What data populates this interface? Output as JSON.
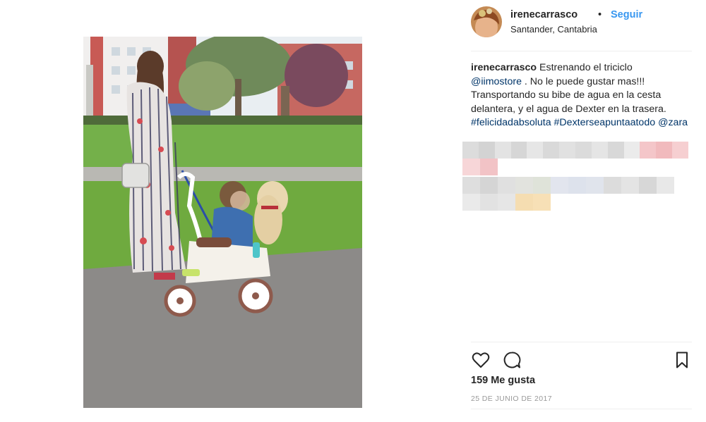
{
  "post": {
    "username": "irenecarrasco",
    "separator": "•",
    "follow_label": "Seguir",
    "location": "Santander, Cantabria",
    "caption": {
      "author": "irenecarrasco",
      "text_1": " Estrenando el triciclo ",
      "mention_store": "@iimostore",
      "text_2": " . No le puede gustar mas!!! Transportando su bibe de agua en la cesta delantera, y el agua de Dexter en la trasera. ",
      "hashtag_1": "#felicidadabsoluta",
      "text_3": " ",
      "hashtag_2": "#Dexterseapuntaatodo",
      "text_4": " ",
      "mention_brand": "@zara"
    },
    "likes_text": "159 Me gusta",
    "date_text": "25 DE JUNIO DE 2017"
  },
  "icons": {
    "like": "heart-icon",
    "comment": "comment-icon",
    "save": "bookmark-icon"
  },
  "colors": {
    "link": "#003569",
    "follow": "#3897f0",
    "muted": "#999999",
    "divider": "#efefef"
  }
}
